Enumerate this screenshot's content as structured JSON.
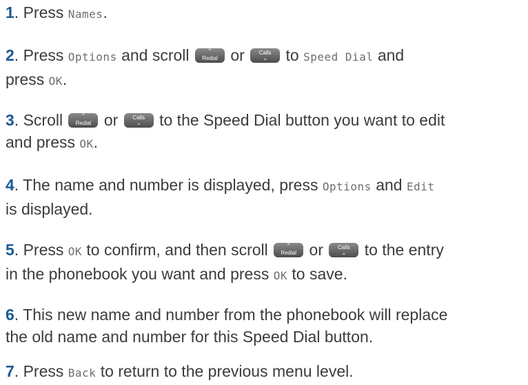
{
  "steps": [
    {
      "num": "1",
      "press": "Press",
      "lcd_names": "Names",
      "dot": "."
    },
    {
      "num": "2",
      "press": "Press",
      "lcd_options": "Options",
      "scroll": "and scroll",
      "or": "or",
      "to": "to",
      "lcd_speed_dial": "Speed Dial",
      "and": "and",
      "press2": "press",
      "lcd_ok": "OK",
      "dot": "."
    },
    {
      "num": "3",
      "scroll": "Scroll",
      "or": "or",
      "rest": "to the Speed Dial button you want to edit",
      "and_press": "and press",
      "lcd_ok": "OK",
      "dot": "."
    },
    {
      "num": "4",
      "text": "The name and number is displayed, press",
      "lcd_options": "Options",
      "and": "and",
      "lcd_edit": "Edit",
      "rest": "is displayed."
    },
    {
      "num": "5",
      "press": "Press",
      "lcd_ok": "OK",
      "mid": "to confirm, and then scroll",
      "or": "or",
      "rest": "to the entry",
      "line2": "in the phonebook you want and press",
      "lcd_ok2": "OK",
      "end": "to save."
    },
    {
      "num": "6",
      "line1": "This new name and number from the phonebook will replace",
      "line2": "the old name and number for this Speed Dial button."
    },
    {
      "num": "7",
      "press": "Press",
      "lcd_back": "Back",
      "rest": "to return to the previous menu level."
    }
  ],
  "keys": {
    "up_chevron": "⌃",
    "redial": "Redial",
    "calls": "Calls",
    "down_chevron": "⌄"
  }
}
